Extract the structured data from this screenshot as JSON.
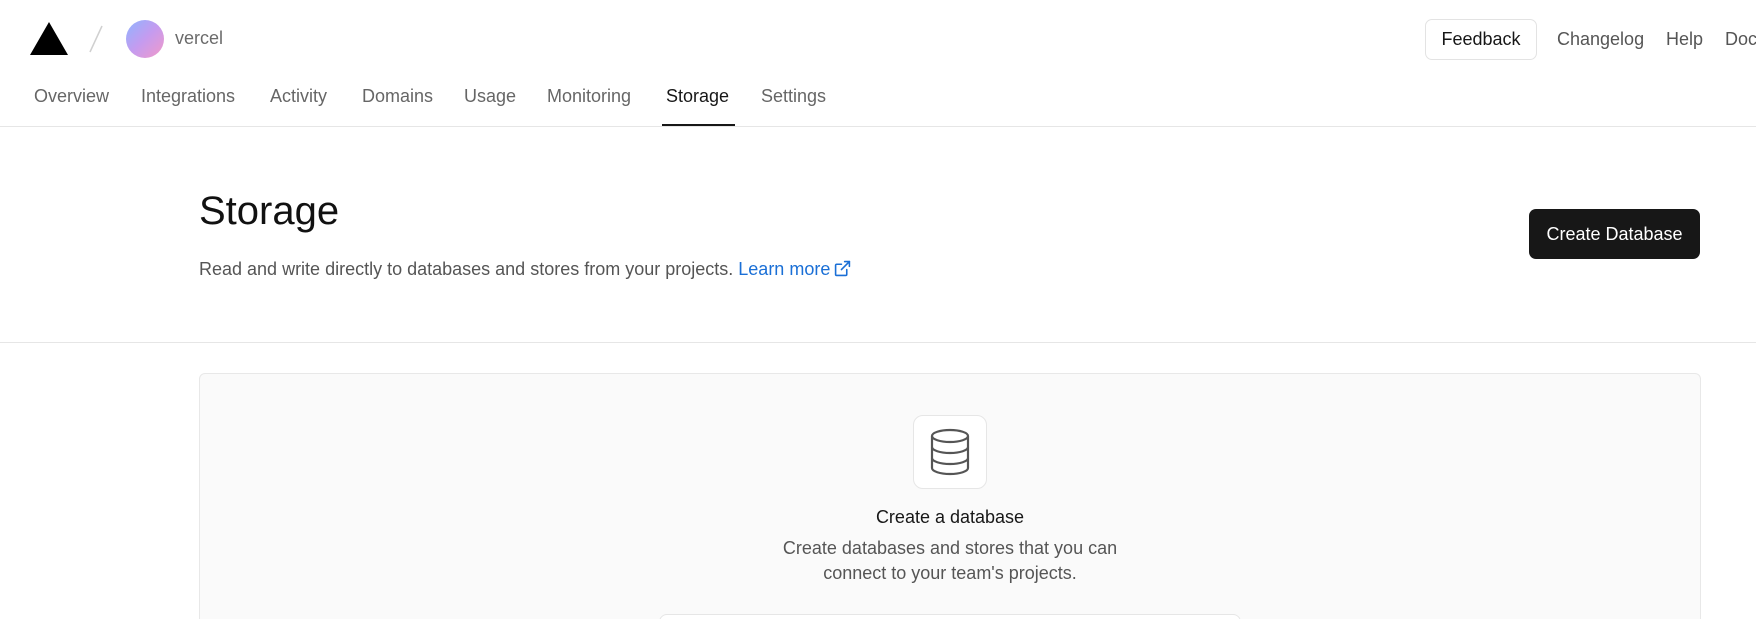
{
  "topbar": {
    "team_name": "vercel",
    "feedback_label": "Feedback",
    "links": [
      "Changelog",
      "Help",
      "Docs"
    ]
  },
  "tabs": [
    {
      "label": "Overview"
    },
    {
      "label": "Integrations"
    },
    {
      "label": "Activity"
    },
    {
      "label": "Domains"
    },
    {
      "label": "Usage"
    },
    {
      "label": "Monitoring"
    },
    {
      "label": "Storage",
      "active": true
    },
    {
      "label": "Settings"
    }
  ],
  "header": {
    "title": "Storage",
    "description": "Read and write directly to databases and stores from your projects.",
    "learn_more": "Learn more",
    "create_button": "Create Database"
  },
  "empty_state": {
    "icon": "database-icon",
    "title": "Create a database",
    "description": "Create databases and stores that you can connect to your team's projects."
  },
  "colors": {
    "accent": "#171717",
    "link": "#1a6fd6",
    "muted_text": "#555555",
    "card_bg": "#fafafa"
  }
}
